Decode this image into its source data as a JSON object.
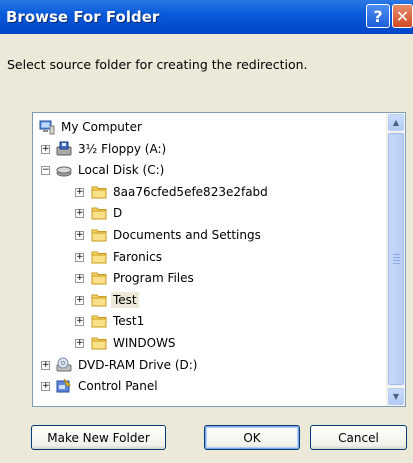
{
  "window": {
    "title": "Browse For Folder",
    "help_label": "?",
    "close_label": "✕"
  },
  "prompt": "Select source folder for creating the redirection.",
  "tree": {
    "items": [
      {
        "label": "My Computer",
        "icon": "computer-icon",
        "level": 0,
        "expander": null,
        "selected": false
      },
      {
        "label": "3½ Floppy (A:)",
        "icon": "floppy-drive-icon",
        "level": 1,
        "expander": "+",
        "selected": false
      },
      {
        "label": "Local Disk (C:)",
        "icon": "hard-disk-icon",
        "level": 1,
        "expander": "−",
        "selected": false
      },
      {
        "label": "8aa76cfed5efe823e2fabd",
        "icon": "folder-icon",
        "level": 2,
        "expander": "+",
        "selected": false
      },
      {
        "label": "D",
        "icon": "folder-icon",
        "level": 2,
        "expander": "+",
        "selected": false
      },
      {
        "label": "Documents and Settings",
        "icon": "folder-icon",
        "level": 2,
        "expander": "+",
        "selected": false
      },
      {
        "label": "Faronics",
        "icon": "folder-icon",
        "level": 2,
        "expander": "+",
        "selected": false
      },
      {
        "label": "Program Files",
        "icon": "folder-icon",
        "level": 2,
        "expander": "+",
        "selected": false
      },
      {
        "label": "Test",
        "icon": "folder-icon",
        "level": 2,
        "expander": "+",
        "selected": true
      },
      {
        "label": "Test1",
        "icon": "folder-icon",
        "level": 2,
        "expander": "+",
        "selected": false
      },
      {
        "label": "WINDOWS",
        "icon": "folder-icon",
        "level": 2,
        "expander": "+",
        "selected": false
      },
      {
        "label": "DVD-RAM Drive (D:)",
        "icon": "dvd-drive-icon",
        "level": 1,
        "expander": "+",
        "selected": false
      },
      {
        "label": "Control Panel",
        "icon": "control-panel-icon",
        "level": 1,
        "expander": "+",
        "selected": false
      }
    ]
  },
  "buttons": {
    "new_folder": "Make New Folder",
    "ok": "OK",
    "cancel": "Cancel"
  },
  "colors": {
    "titlebar": "#0A5BDA",
    "dialog_bg": "#ECE9D8",
    "folder": "#F7D56B",
    "selection": "#ECE9D8"
  }
}
